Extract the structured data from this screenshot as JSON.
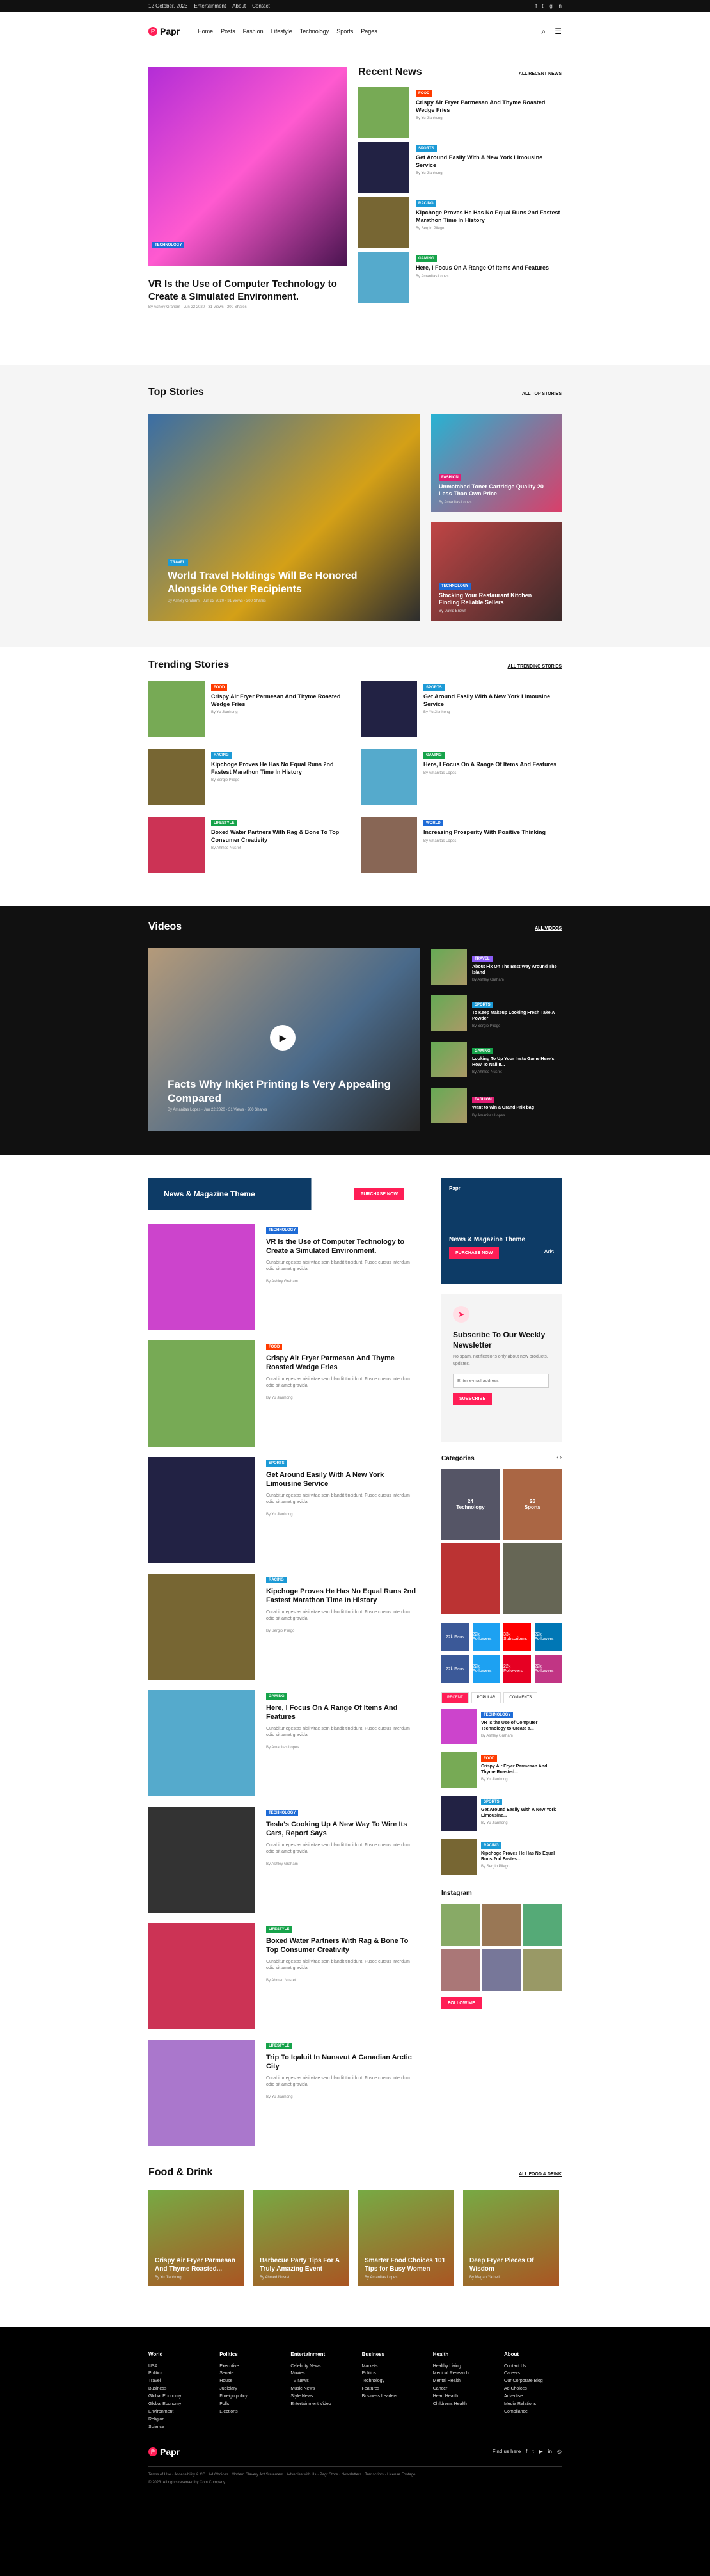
{
  "topbar": {
    "date": "12 October, 2023",
    "links": [
      "Entertainment",
      "About",
      "Contact"
    ],
    "social": [
      "f",
      "t",
      "ig",
      "in"
    ]
  },
  "header": {
    "logo": "Papr",
    "nav": [
      "Home",
      "Posts",
      "Fashion",
      "Lifestyle",
      "Technology",
      "Sports",
      "Pages"
    ]
  },
  "featured": {
    "badge": "TECHNOLOGY",
    "title": "VR Is the Use of Computer Technology to Create a Simulated Environment.",
    "meta": "By Ashley Graham  ·  Jun 22 2020  ·  31 Views  ·  200 Shares"
  },
  "recent": {
    "title": "Recent News",
    "all": "ALL RECENT NEWS",
    "items": [
      {
        "badge": "FOOD",
        "title": "Crispy Air Fryer Parmesan And Thyme Roasted Wedge Fries",
        "author": "By Yu Jianhong"
      },
      {
        "badge": "SPORTS",
        "title": "Get Around Easily With A New York Limousine Service",
        "author": "By Yu Jianhong"
      },
      {
        "badge": "RACING",
        "title": "Kipchoge Proves He Has No Equal Runs 2nd Fastest Marathon Time In History",
        "author": "By Sergio Pliego"
      },
      {
        "badge": "GAMING",
        "title": "Here, I Focus On A Range Of Items And Features",
        "author": "By Amanitas Lopes"
      }
    ]
  },
  "top": {
    "title": "Top Stories",
    "all": "ALL TOP STORIES",
    "main": {
      "badge": "TRAVEL",
      "title": "World Travel Holdings Will Be Honored Alongside Other Recipients",
      "meta": "By Ashley Graham  ·  Jun 22 2020  ·  31 Views  ·  200 Shares"
    },
    "side": [
      {
        "badge": "FASHION",
        "title": "Unmatched Toner Cartridge Quality 20 Less Than Own Price",
        "author": "By Amanitas Lopes"
      },
      {
        "badge": "TECHNOLOGY",
        "title": "Stocking Your Restaurant Kitchen Finding Reliable Sellers",
        "author": "By David Brown"
      }
    ]
  },
  "trending": {
    "title": "Trending Stories",
    "all": "ALL TRENDING STORIES",
    "items": [
      {
        "badge": "FOOD",
        "title": "Crispy Air Fryer Parmesan And Thyme Roasted Wedge Fries",
        "author": "By Yu Jianhong"
      },
      {
        "badge": "SPORTS",
        "title": "Get Around Easily With A New York Limousine Service",
        "author": "By Yu Jianhong"
      },
      {
        "badge": "RACING",
        "title": "Kipchoge Proves He Has No Equal Runs 2nd Fastest Marathon Time In History",
        "author": "By Sergio Pliego"
      },
      {
        "badge": "GAMING",
        "title": "Here, I Focus On A Range Of Items And Features",
        "author": "By Amanitas Lopes"
      },
      {
        "badge": "LIFESTYLE",
        "title": "Boxed Water Partners With Rag & Bone To Top Consumer Creativity",
        "author": "By Ahmed Nusret"
      },
      {
        "badge": "WORLD",
        "title": "Increasing Prosperity With Positive Thinking",
        "author": "By Amanitas Lopes"
      }
    ]
  },
  "videos": {
    "title": "Videos",
    "all": "ALL VIDEOS",
    "main": {
      "title": "Facts Why Inkjet Printing Is Very Appealing Compared",
      "meta": "By Amanitas Lopes  ·  Jun 22 2020  ·  31 Views  ·  200 Shares"
    },
    "list": [
      {
        "badge": "TRAVEL",
        "title": "About Fix On The Best Way Around The Island",
        "author": "By Ashley Graham"
      },
      {
        "badge": "SPORTS",
        "title": "To Keep Makeup Looking Fresh Take A Powder",
        "author": "By Sergio Pliego"
      },
      {
        "badge": "GAMING",
        "title": "Looking To Up Your Insta Game Here's How To Nail It...",
        "author": "By Ahmed Nusret"
      },
      {
        "badge": "FASHION",
        "title": "Want to win a Grand Prix bag",
        "author": "By Amanitas Lopes"
      }
    ]
  },
  "banner": {
    "title": "News & Magazine Theme",
    "btn": "PURCHASE NOW"
  },
  "articles": [
    {
      "badge": "TECHNOLOGY",
      "title": "VR Is the Use of Computer Technology to Create a Simulated Environment.",
      "excerpt": "Curabitur egestas nisi vitae sem blandit tincidunt. Fusce cursus interdum odio sit amet gravida.",
      "author": "By Ashley Graham"
    },
    {
      "badge": "FOOD",
      "title": "Crispy Air Fryer Parmesan And Thyme Roasted Wedge Fries",
      "excerpt": "Curabitur egestas nisi vitae sem blandit tincidunt. Fusce cursus interdum odio sit amet gravida.",
      "author": "By Yu Jianhong"
    },
    {
      "badge": "SPORTS",
      "title": "Get Around Easily With A New York Limousine Service",
      "excerpt": "Curabitur egestas nisi vitae sem blandit tincidunt. Fusce cursus interdum odio sit amet gravida.",
      "author": "By Yu Jianhong"
    },
    {
      "badge": "RACING",
      "title": "Kipchoge Proves He Has No Equal Runs 2nd Fastest Marathon Time In History",
      "excerpt": "Curabitur egestas nisi vitae sem blandit tincidunt. Fusce cursus interdum odio sit amet gravida.",
      "author": "By Sergio Pliego"
    },
    {
      "badge": "GAMING",
      "title": "Here, I Focus On A Range Of Items And Features",
      "excerpt": "Curabitur egestas nisi vitae sem blandit tincidunt. Fusce cursus interdum odio sit amet gravida.",
      "author": "By Amanitas Lopes"
    },
    {
      "badge": "TECHNOLOGY",
      "title": "Tesla's Cooking Up A New Way To Wire Its Cars, Report Says",
      "excerpt": "Curabitur egestas nisi vitae sem blandit tincidunt. Fusce cursus interdum odio sit amet gravida.",
      "author": "By Ashley Graham"
    },
    {
      "badge": "LIFESTYLE",
      "title": "Boxed Water Partners With Rag & Bone To Top Consumer Creativity",
      "excerpt": "Curabitur egestas nisi vitae sem blandit tincidunt. Fusce cursus interdum odio sit amet gravida.",
      "author": "By Ahmed Nusret"
    },
    {
      "badge": "LIFESTYLE",
      "title": "Trip To Iqaluit In Nunavut A Canadian Arctic City",
      "excerpt": "Curabitur egestas nisi vitae sem blandit tincidunt. Fusce cursus interdum odio sit amet gravida.",
      "author": "By Yu Jianhong"
    }
  ],
  "sidebar": {
    "ad": {
      "logo": "Papr",
      "title": "News & Magazine Theme",
      "btn": "PURCHASE NOW",
      "tag": "Ads"
    },
    "newsletter": {
      "title": "Subscribe To Our Weekly Newsletter",
      "text": "No spam, notifications only about new products, updates.",
      "placeholder": "Enter e-mail address",
      "btn": "SUBSCRIBE"
    },
    "categories": {
      "title": "Categories",
      "items": [
        {
          "n": "24",
          "l": "Technology"
        },
        {
          "n": "26",
          "l": "Sports"
        },
        {
          "n": "",
          "l": ""
        },
        {
          "n": "",
          "l": ""
        }
      ]
    },
    "social": [
      {
        "c": "#3b5998",
        "l": "22k Fans"
      },
      {
        "c": "#1da1f2",
        "l": "22k Followers"
      },
      {
        "c": "#ff0000",
        "l": "33k Subscribers"
      },
      {
        "c": "#0077b5",
        "l": "22k Followers"
      },
      {
        "c": "#3b5998",
        "l": "22k Fans"
      },
      {
        "c": "#1da1f2",
        "l": "22k Followers"
      },
      {
        "c": "#e60023",
        "l": "22k Followers"
      },
      {
        "c": "#c13584",
        "l": "22k Followers"
      }
    ],
    "tabs": [
      "RECENT",
      "POPULAR",
      "COMMENTS"
    ],
    "popular": [
      {
        "badge": "TECHNOLOGY",
        "title": "VR Is the Use of Computer Technology to Create a...",
        "author": "By Ashley Graham"
      },
      {
        "badge": "FOOD",
        "title": "Crispy Air Fryer Parmesan And Thyme Roasted...",
        "author": "By Yu Jianhong"
      },
      {
        "badge": "SPORTS",
        "title": "Get Around Easily With A New York Limousine...",
        "author": "By Yu Jianhong"
      },
      {
        "badge": "RACING",
        "title": "Kipchoge Proves He Has No Equal Runs 2nd Fastes...",
        "author": "By Sergio Pliego"
      }
    ],
    "instagram": {
      "title": "Instagram",
      "btn": "FOLLOW ME"
    }
  },
  "food": {
    "title": "Food & Drink",
    "all": "ALL FOOD & DRINK",
    "items": [
      {
        "title": "Crispy Air Fryer Parmesan And Thyme Roasted...",
        "author": "By Yu Jianhong"
      },
      {
        "title": "Barbecue Party Tips For A Truly Amazing Event",
        "author": "By Ahmed Nusret"
      },
      {
        "title": "Smarter Food Choices 101 Tips for Busy Women",
        "author": "By Amanitas Lopes"
      },
      {
        "title": "Deep Fryer Pieces Of Wisdom",
        "author": "By Magah Yarhell"
      }
    ]
  },
  "footer": {
    "cols": [
      {
        "t": "World",
        "l": [
          "USA",
          "Politics",
          "Travel",
          "Business",
          "Global Economy",
          "Global Economy",
          "Environment",
          "Religion",
          "Science"
        ]
      },
      {
        "t": "Politics",
        "l": [
          "Executive",
          "Senate",
          "House",
          "Judiciary",
          "Foreign policy",
          "Polls",
          "Elections"
        ]
      },
      {
        "t": "Entertainment",
        "l": [
          "Celebrity News",
          "Movies",
          "TV News",
          "Music News",
          "Style News",
          "Entertainment Video"
        ]
      },
      {
        "t": "Business",
        "l": [
          "Markets",
          "Politics",
          "Technology",
          "Features",
          "Business Leaders"
        ]
      },
      {
        "t": "Health",
        "l": [
          "Healthy Living",
          "Medical Research",
          "Mental Health",
          "Cancer",
          "Heart Health",
          "Children's Health"
        ]
      },
      {
        "t": "About",
        "l": [
          "Contact Us",
          "Careers",
          "Our Corporate Blog",
          "Ad Choices",
          "Advertise",
          "Media Relations",
          "Compliance"
        ]
      }
    ],
    "logo": "Papr",
    "find": "Find us here",
    "links": "Terms of Use  ·  Accessibility & CC  ·  Ad Choices  ·  Modern Slavery Act Statement  ·  Advertise with Us  ·  Pagr Store  ·  Newsletters  ·  Transcripts  ·  License Footage",
    "copy": "© 2023. All rights reserved by Com Company"
  }
}
